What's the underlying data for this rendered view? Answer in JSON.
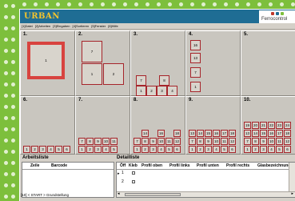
{
  "app": {
    "logo": "URBAN",
    "brand": "Ferrocontrol"
  },
  "menu": [
    "[1]Datei",
    "[2]Arbeiten",
    "[3]Eingaben",
    "[4]Sortieren",
    "[5]Fenster",
    "[6]Hilfe"
  ],
  "sections": {
    "s1": "1.",
    "s2": "2.",
    "s3": "3.",
    "s4": "4.",
    "s5": "5.",
    "s6": "6.",
    "s7": "7.",
    "s8": "8.",
    "s9": "9.",
    "s10": "10."
  },
  "boxes": {
    "s1": [
      "1"
    ],
    "s2": [
      "7",
      "1",
      "2"
    ],
    "s3": [
      "7",
      "8",
      "1",
      "2",
      "3",
      "4"
    ],
    "s4": [
      "16",
      "13",
      "7",
      "1"
    ],
    "s6": [
      "1",
      "2",
      "3",
      "4",
      "5",
      "6"
    ],
    "s7": [
      "7",
      "8",
      "9",
      "10",
      "11",
      "1",
      "2",
      "3",
      "4",
      "5"
    ],
    "s8": [
      "14",
      "16",
      "18",
      "7",
      "8",
      "9",
      "10",
      "11",
      "12",
      "1",
      "2",
      "3",
      "4",
      "5",
      "6"
    ],
    "s9": [
      "13",
      "14",
      "15",
      "16",
      "17",
      "18",
      "7",
      "8",
      "9",
      "10",
      "11",
      "12",
      "1",
      "2",
      "3",
      "4",
      "5",
      "6"
    ],
    "s10": [
      "19",
      "20",
      "21",
      "22",
      "23",
      "24",
      "13",
      "14",
      "15",
      "16",
      "17",
      "18",
      "7",
      "8",
      "9",
      "10",
      "11",
      "12",
      "1",
      "2",
      "3",
      "4",
      "5",
      "6"
    ]
  },
  "worklist": {
    "title": "Arbeitsliste",
    "columns": [
      "Zeile",
      "Barcode"
    ]
  },
  "detaillist": {
    "title": "Detailliste",
    "columns": [
      "Öff",
      "Kleb",
      "Profil oben",
      "Profil links",
      "Profil unten",
      "Profil rechts",
      "Glasbezeichnung"
    ],
    "rows": [
      "1",
      "2"
    ]
  },
  "status": "[10] < START > Grundstellung",
  "colors": {
    "background": "#7dbf3c",
    "header": "#1f6d94",
    "box_border": "#a6252b",
    "box_border_big": "#d8433f"
  }
}
